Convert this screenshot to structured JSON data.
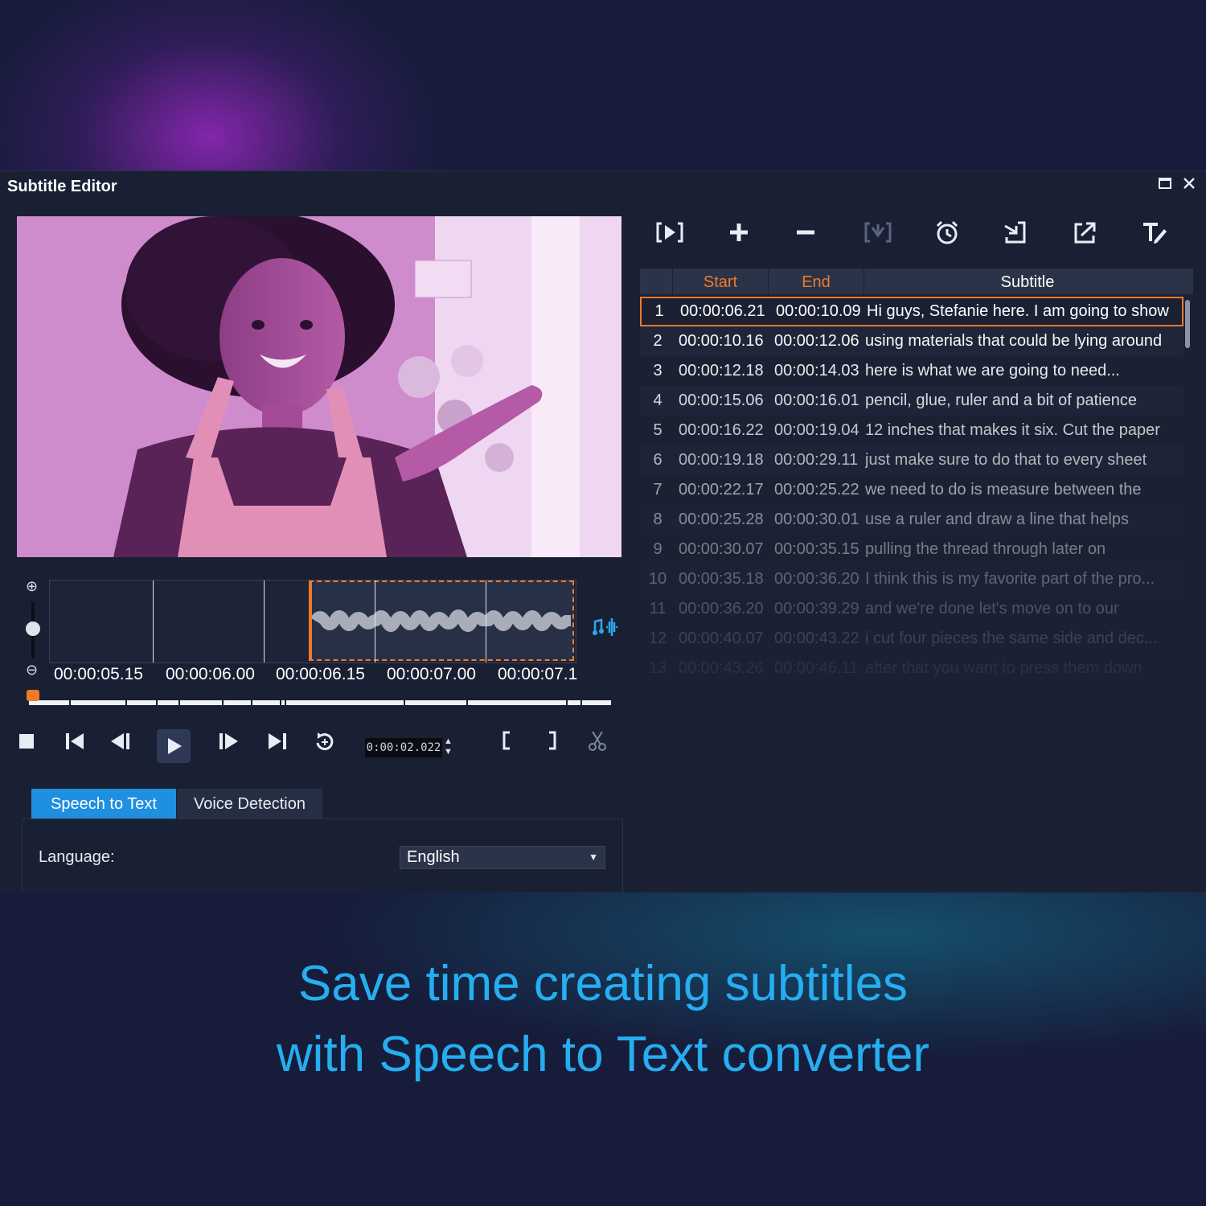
{
  "window": {
    "title": "Subtitle Editor",
    "maximize_icon": "maximize-icon",
    "close_icon": "close-icon"
  },
  "timeline": {
    "labels": [
      "00:00:05.15",
      "00:00:06.00",
      "00:00:06.15",
      "00:00:07.00",
      "00:00:07.1"
    ],
    "timecode": "0:00:02.022"
  },
  "tabs": {
    "speech_to_text": "Speech to Text",
    "voice_detection": "Voice Detection"
  },
  "language": {
    "label": "Language:",
    "value": "English"
  },
  "toolbar_icons": [
    "play-subtitle-icon",
    "add-icon",
    "remove-icon",
    "merge-icon",
    "alarm-icon",
    "import-icon",
    "export-icon",
    "text-format-icon"
  ],
  "grid": {
    "headers": {
      "number": "",
      "start": "Start",
      "end": "End",
      "subtitle": "Subtitle"
    },
    "rows": [
      {
        "no": "1",
        "start": "00:00:06.21",
        "end": "00:00:10.09",
        "text": "Hi guys, Stefanie here. I am going to show"
      },
      {
        "no": "2",
        "start": "00:00:10.16",
        "end": "00:00:12.06",
        "text": "using materials that could be lying around"
      },
      {
        "no": "3",
        "start": "00:00:12.18",
        "end": "00:00:14.03",
        "text": "here is what we are going to need..."
      },
      {
        "no": "4",
        "start": "00:00:15.06",
        "end": "00:00:16.01",
        "text": "pencil, glue, ruler and a bit of patience"
      },
      {
        "no": "5",
        "start": "00:00:16.22",
        "end": "00:00:19.04",
        "text": "12 inches that makes it six. Cut the paper"
      },
      {
        "no": "6",
        "start": "00:00:19.18",
        "end": "00:00:29.11",
        "text": "just make sure to do that to every sheet"
      },
      {
        "no": "7",
        "start": "00:00:22.17",
        "end": "00:00:25.22",
        "text": "we need to do is measure between the"
      },
      {
        "no": "8",
        "start": "00:00:25.28",
        "end": "00:00:30.01",
        "text": "use a ruler and draw a line that helps"
      },
      {
        "no": "9",
        "start": "00:00:30.07",
        "end": "00:00:35.15",
        "text": "pulling the thread through later on"
      },
      {
        "no": "10",
        "start": "00:00:35.18",
        "end": "00:00:36.20",
        "text": "I think this is my favorite part of the pro..."
      },
      {
        "no": "11",
        "start": "00:00:36.20",
        "end": "00:00:39.29",
        "text": "and we're done let's move on to our"
      },
      {
        "no": "12",
        "start": "00:00:40.07",
        "end": "00:00:43.22",
        "text": "i cut four pieces the same side and dec..."
      },
      {
        "no": "13",
        "start": "00:00:43.26",
        "end": "00:00:46.11",
        "text": "after that you want to press them down"
      }
    ]
  },
  "caption": {
    "line1": "Save time creating subtitles",
    "line2": "with Speech to Text converter"
  },
  "colors": {
    "accent": "#f07a2a",
    "tab_active": "#1f8fe0",
    "caption": "#25aef0"
  }
}
